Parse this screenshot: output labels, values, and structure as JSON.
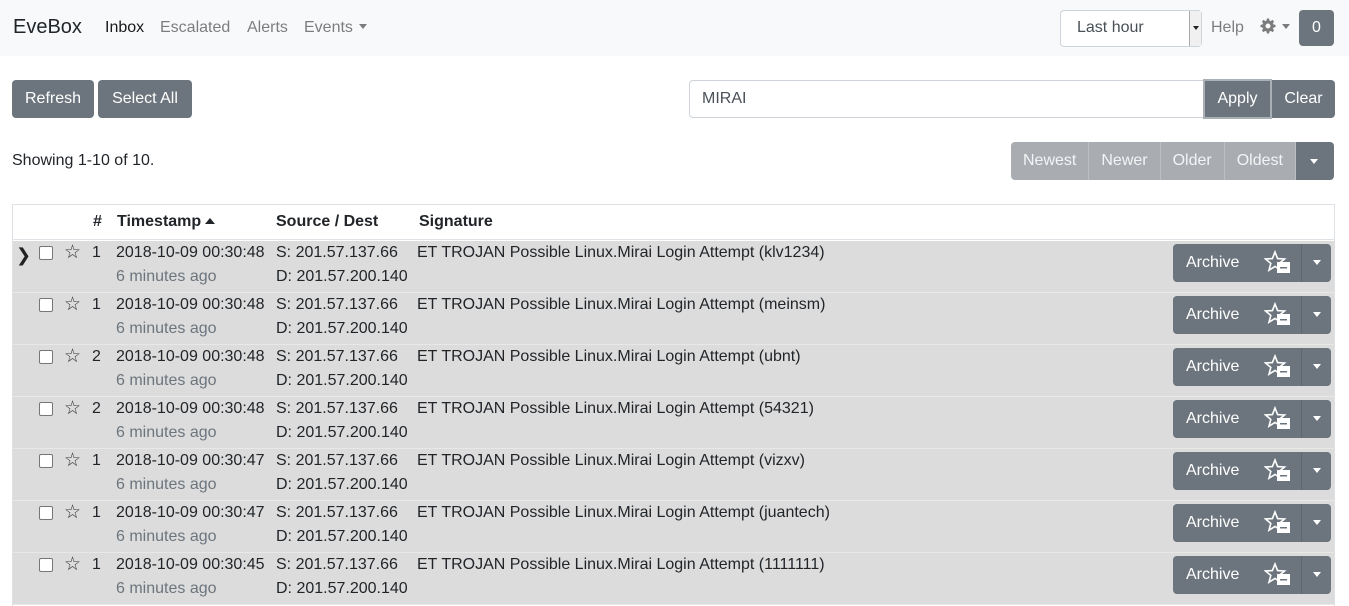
{
  "navbar": {
    "brand": "EveBox",
    "links": [
      "Inbox",
      "Escalated",
      "Alerts",
      "Events"
    ],
    "time_range": "Last hour",
    "help": "Help",
    "badge_count": "0"
  },
  "toolbar": {
    "refresh": "Refresh",
    "select_all": "Select All",
    "search_value": "MIRAI",
    "apply": "Apply",
    "clear": "Clear"
  },
  "status": {
    "showing": "Showing 1-10 of 10."
  },
  "pager": [
    "Newest",
    "Newer",
    "Older",
    "Oldest"
  ],
  "table": {
    "headers": {
      "count": "#",
      "timestamp": "Timestamp",
      "source_dest": "Source / Dest",
      "signature": "Signature"
    },
    "archive_label": "Archive",
    "rows": [
      {
        "count": "1",
        "timestamp": "2018-10-09 00:30:48",
        "ago": "6 minutes ago",
        "src": "S: 201.57.137.66",
        "dst": "D: 201.57.200.140",
        "signature": "ET TROJAN Possible Linux.Mirai Login Attempt (klv1234)"
      },
      {
        "count": "1",
        "timestamp": "2018-10-09 00:30:48",
        "ago": "6 minutes ago",
        "src": "S: 201.57.137.66",
        "dst": "D: 201.57.200.140",
        "signature": "ET TROJAN Possible Linux.Mirai Login Attempt (meinsm)"
      },
      {
        "count": "2",
        "timestamp": "2018-10-09 00:30:48",
        "ago": "6 minutes ago",
        "src": "S: 201.57.137.66",
        "dst": "D: 201.57.200.140",
        "signature": "ET TROJAN Possible Linux.Mirai Login Attempt (ubnt)"
      },
      {
        "count": "2",
        "timestamp": "2018-10-09 00:30:48",
        "ago": "6 minutes ago",
        "src": "S: 201.57.137.66",
        "dst": "D: 201.57.200.140",
        "signature": "ET TROJAN Possible Linux.Mirai Login Attempt (54321)"
      },
      {
        "count": "1",
        "timestamp": "2018-10-09 00:30:47",
        "ago": "6 minutes ago",
        "src": "S: 201.57.137.66",
        "dst": "D: 201.57.200.140",
        "signature": "ET TROJAN Possible Linux.Mirai Login Attempt (vizxv)"
      },
      {
        "count": "1",
        "timestamp": "2018-10-09 00:30:47",
        "ago": "6 minutes ago",
        "src": "S: 201.57.137.66",
        "dst": "D: 201.57.200.140",
        "signature": "ET TROJAN Possible Linux.Mirai Login Attempt (juantech)"
      },
      {
        "count": "1",
        "timestamp": "2018-10-09 00:30:45",
        "ago": "6 minutes ago",
        "src": "S: 201.57.137.66",
        "dst": "D: 201.57.200.140",
        "signature": "ET TROJAN Possible Linux.Mirai Login Attempt (1111111)"
      }
    ]
  }
}
